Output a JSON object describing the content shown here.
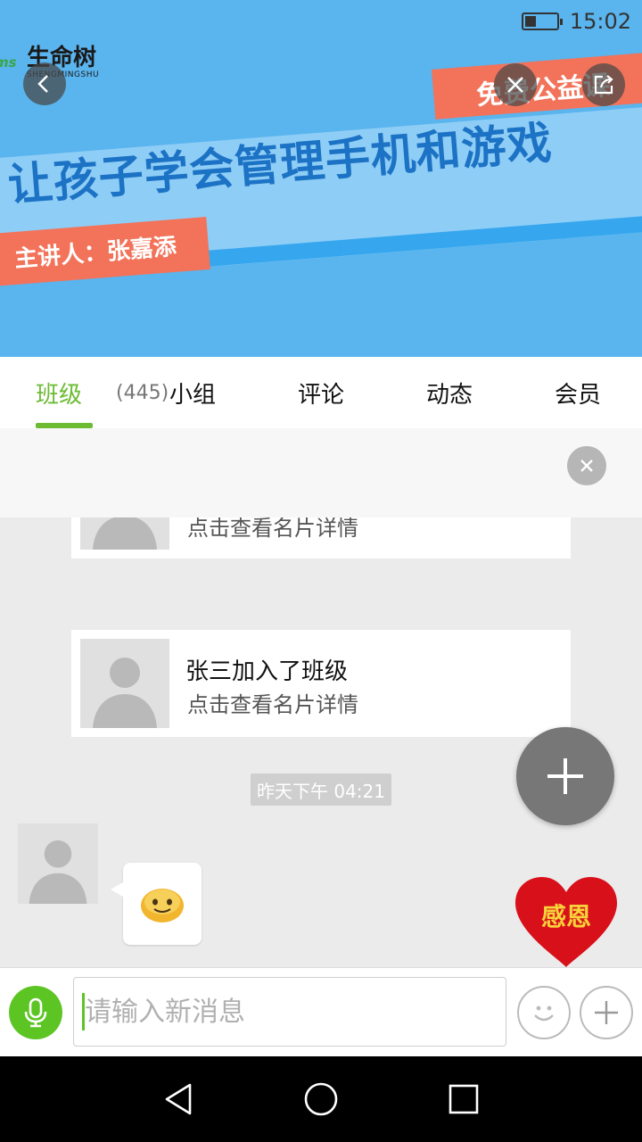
{
  "status_bar": {
    "time": "15:02",
    "battery_level": 0.35
  },
  "banner": {
    "logo_cn": "生命树",
    "logo_en": "SHENGMINGSHU",
    "logo_mark": "ms",
    "badge": "免费公益课",
    "headline": "让孩子学会管理手机和游戏",
    "speaker": "主讲人：张嘉添"
  },
  "tabs": [
    {
      "label": "班级",
      "count": "(445)",
      "active": true
    },
    {
      "label": "小组"
    },
    {
      "label": "评论"
    },
    {
      "label": "动态"
    },
    {
      "label": "会员"
    }
  ],
  "chat": {
    "card_top": {
      "line2": "点击查看名片详情"
    },
    "card_join": {
      "line1": "张三加入了班级",
      "line2": "点击查看名片详情"
    },
    "timestamp": "昨天下午 04:21"
  },
  "floating": {
    "gratitude_label": "感恩"
  },
  "input": {
    "placeholder": "请输入新消息",
    "value": ""
  },
  "colors": {
    "accent": "#6cbb33",
    "banner_bg": "#5ab4ee",
    "badge": "#f2735a",
    "heart": "#d8101a"
  }
}
